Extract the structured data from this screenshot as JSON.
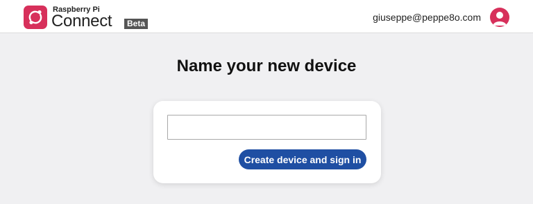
{
  "header": {
    "brand_small": "Raspberry Pi",
    "brand_main": "Connect",
    "beta_badge": "Beta",
    "user_email": "giuseppe@peppe8o.com",
    "logo_icon": "raspberry-pi-connect-logo-icon",
    "avatar_icon": "user-avatar-icon"
  },
  "main": {
    "title": "Name your new device",
    "device_name_input": {
      "value": "",
      "placeholder": ""
    },
    "create_button_label": "Create device and sign in"
  },
  "colors": {
    "brand_red": "#d7305b",
    "button_blue": "#1f4fa3",
    "page_bg": "#f0f0f2"
  }
}
